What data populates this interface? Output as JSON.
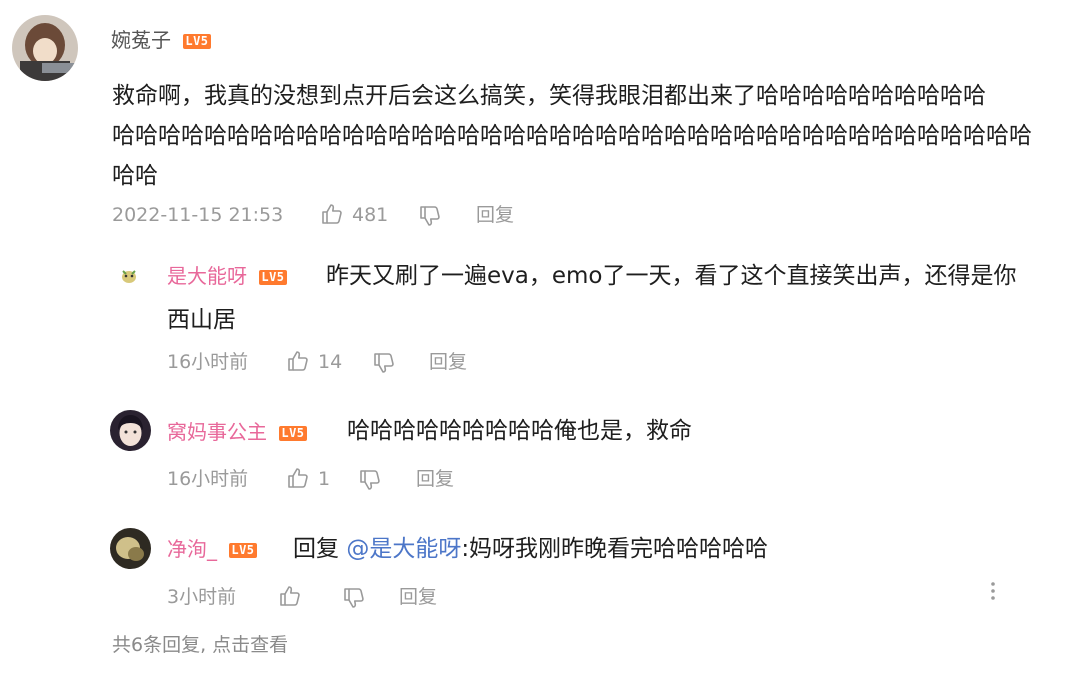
{
  "main_comment": {
    "username": "婉菟子",
    "level": "LV5",
    "text_lines": [
      "救命啊，我真的没想到点开后会这么搞笑，笑得我眼泪都出来了哈哈哈哈哈哈哈哈哈哈",
      "哈哈哈哈哈哈哈哈哈哈哈哈哈哈哈哈哈哈哈哈哈哈哈哈哈哈哈哈哈哈哈哈哈哈哈哈哈哈哈哈",
      "哈哈"
    ],
    "timestamp": "2022-11-15 21:53",
    "likes": "481",
    "reply_label": "回复"
  },
  "replies": [
    {
      "username": "是大能呀",
      "level": "LV5",
      "text_line1": "昨天又刷了一遍eva，emo了一天，看了这个直接笑出声，还得是你",
      "text_line2": "西山居",
      "time": "16小时前",
      "likes": "14",
      "reply_label": "回复"
    },
    {
      "username": "窝妈事公主",
      "level": "LV5",
      "text": "哈哈哈哈哈哈哈哈哈俺也是，救命",
      "time": "16小时前",
      "likes": "1",
      "reply_label": "回复"
    },
    {
      "username": "净洵_",
      "level": "LV5",
      "reply_prefix": "回复",
      "mention": "@是大能呀",
      "text": ":妈呀我刚昨晚看完哈哈哈哈哈",
      "time": "3小时前",
      "likes": "",
      "reply_label": "回复"
    }
  ],
  "footer": {
    "more_replies": "共6条回复, 点击查看"
  },
  "colors": {
    "username_main": "#555555",
    "username_reply": "#e8689a",
    "mention": "#4c76c8",
    "level_badge": "#ff7a2e",
    "meta": "#9a9a9a"
  },
  "icons": [
    "thumbs-up-icon",
    "thumbs-down-icon",
    "more-vertical-icon"
  ]
}
